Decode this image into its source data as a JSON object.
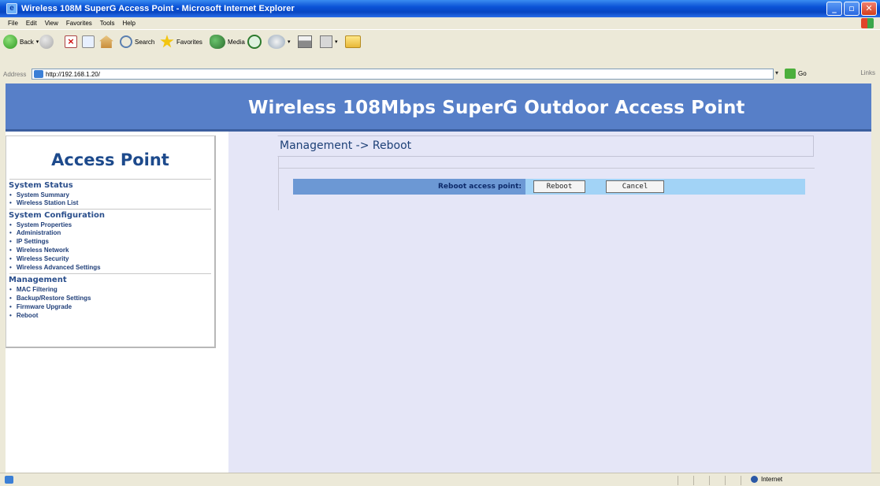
{
  "window": {
    "title": "Wireless 108M SuperG Access Point - Microsoft Internet Explorer",
    "controls": [
      "minimize-icon",
      "maximize-icon",
      "close-icon"
    ]
  },
  "menu": [
    "File",
    "Edit",
    "View",
    "Favorites",
    "Tools",
    "Help"
  ],
  "toolbar": {
    "back_label": "Back",
    "search_label": "Search",
    "favorites_label": "Favorites",
    "media_label": "Media"
  },
  "address": {
    "label": "Address",
    "value": "http://192.168.1.20/",
    "go_label": "Go",
    "links_label": "Links"
  },
  "banner": {
    "title": "Wireless 108Mbps SuperG Outdoor Access Point"
  },
  "sidebar": {
    "heading": "Access Point",
    "sections": [
      {
        "title": "System Status",
        "items": [
          "System Summary",
          "Wireless Station List"
        ]
      },
      {
        "title": "System Configuration",
        "items": [
          "System Properties",
          "Administration",
          "IP Settings",
          "Wireless Network",
          "Wireless Security",
          "Wireless Advanced Settings"
        ]
      },
      {
        "title": "Management",
        "items": [
          "MAC Filtering",
          "Backup/Restore Settings",
          "Firmware Upgrade",
          "Reboot"
        ]
      }
    ]
  },
  "main": {
    "breadcrumb": "Management -> Reboot",
    "reboot_label": "Reboot access point:",
    "reboot_button": "Reboot",
    "cancel_button": "Cancel"
  },
  "status": {
    "zone": "Internet"
  },
  "colors": {
    "banner": "#577fc8",
    "content_bg": "#e5e6f7",
    "label_cell": "#6c98d4",
    "control_cell": "#a2d3f6",
    "nav_text": "#21407a"
  }
}
